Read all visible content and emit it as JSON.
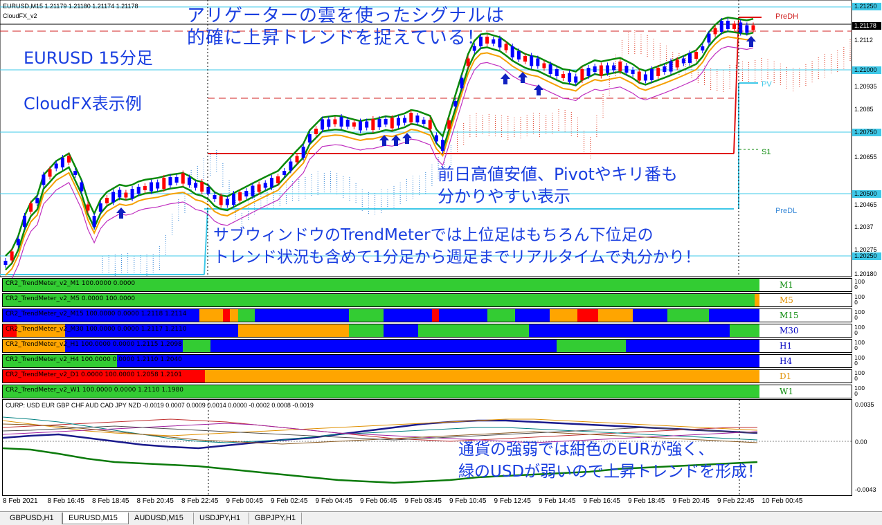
{
  "window": {
    "symbol_title": "EURUSD,M15  1.21179 1.21180 1.21174 1.21178",
    "indicator_label": "CloudFX_v2"
  },
  "colors": {
    "background": "#ffffff",
    "bull_candle": "#0000ff",
    "bear_candle": "#ff0000",
    "green_band": "#0a8a0a",
    "orange_ma": "#f5a000",
    "magenta_ma": "#c030c0",
    "cloud_red": "#e0402a",
    "cloud_blue": "#3a8ad8",
    "cyan_level": "#3ec8e8",
    "annotation_blue": "#1a3fe0",
    "meter_green": "#33cc33",
    "meter_blue": "#0000ff",
    "meter_orange": "#ffa500",
    "meter_red": "#ff0000"
  },
  "annotations": {
    "headline_1": "アリゲーターの雲を使ったシグナルは",
    "headline_2": "的確に上昇トレンドを捉えている！",
    "pair_label": "EURUSD 15分足",
    "cloudfx_label": "CloudFX表示例",
    "pivot_1": "前日高値安値、Pivotやキリ番も",
    "pivot_2": "分かりやすい表示",
    "trendmeter_1": "サブウィンドウのTrendMeterでは上位足はもちろん下位足の",
    "trendmeter_2": "トレンド状況も含めて1分足から週足までリアルタイムで丸分かり！",
    "strength_1": "通貨の強弱では紺色のEURが強く、",
    "strength_2": "緑のUSDが弱いので上昇トレンドを形成！"
  },
  "levels": {
    "predh": "PreDH",
    "pv": "PV",
    "s1": "S1",
    "predl": "PreDL"
  },
  "price_axis": {
    "labels": [
      "1.21250",
      "1.21178",
      "1.2112",
      "1.21000",
      "1.20935",
      "1.2085",
      "1.20750",
      "1.20655",
      "1.20500",
      "1.20465",
      "1.2037",
      "1.20275",
      "1.20250",
      "1.20180"
    ],
    "current": "1.21178"
  },
  "trend_meters": [
    {
      "label": "CR2_TrendMeter_v2_M1 100.0000 0.0000",
      "tf": "M1",
      "tf_color": "#0a8a0a"
    },
    {
      "label": "CR2_TrendMeter_v2_M5 0.0000 100.0000",
      "tf": "M5",
      "tf_color": "#e09000"
    },
    {
      "label": "CR2_TrendMeter_v2_M15 100.0000 0.0000 1.2118 1.2114",
      "tf": "M15",
      "tf_color": "#0a8a0a"
    },
    {
      "label": "CR2_TrendMeter_v2_M30 100.0000 0.0000 1.2117 1.2110",
      "tf": "M30",
      "tf_color": "#0000c0"
    },
    {
      "label": "CR2_TrendMeter_v2_H1 100.0000 0.0000 1.2115 1.2098",
      "tf": "H1",
      "tf_color": "#0000c0"
    },
    {
      "label": "CR2_TrendMeter_v2_H4 100.0000 0.0000 1.2110 1.2040",
      "tf": "H4",
      "tf_color": "#0000c0"
    },
    {
      "label": "CR2_TrendMeter_v2_D1 0.0000 100.0000 1.2058 1.2101",
      "tf": "D1",
      "tf_color": "#e09000"
    },
    {
      "label": "CR2_TrendMeter_v2_W1 100.0000 0.0000 1.2110 1.1980",
      "tf": "W1",
      "tf_color": "#0a8a0a"
    }
  ],
  "meter_scale": {
    "top": "100",
    "bottom": "0"
  },
  "currency_strength": {
    "label": "CURP: USD EUR GBP CHF AUD CAD JPY NZD -0.0019 0.0007 0.0009 0.0014 0.0000 -0.0002 0.0008 -0.0019",
    "axis": [
      "0.0035",
      "0.00",
      "-0.0043"
    ]
  },
  "time_axis": [
    "8 Feb 2021",
    "8 Feb 16:45",
    "8 Feb 18:45",
    "8 Feb 20:45",
    "8 Feb 22:45",
    "9 Feb 00:45",
    "9 Feb 02:45",
    "9 Feb 04:45",
    "9 Feb 06:45",
    "9 Feb 08:45",
    "9 Feb 10:45",
    "9 Feb 12:45",
    "9 Feb 14:45",
    "9 Feb 16:45",
    "9 Feb 18:45",
    "9 Feb 20:45",
    "9 Feb 22:45",
    "10 Feb 00:45"
  ],
  "tabs": [
    {
      "label": "GBPUSD,H1",
      "active": false
    },
    {
      "label": "EURUSD,M15",
      "active": true
    },
    {
      "label": "AUDUSD,M15",
      "active": false
    },
    {
      "label": "USDJPY,H1",
      "active": false
    },
    {
      "label": "GBPJPY,H1",
      "active": false
    }
  ]
}
